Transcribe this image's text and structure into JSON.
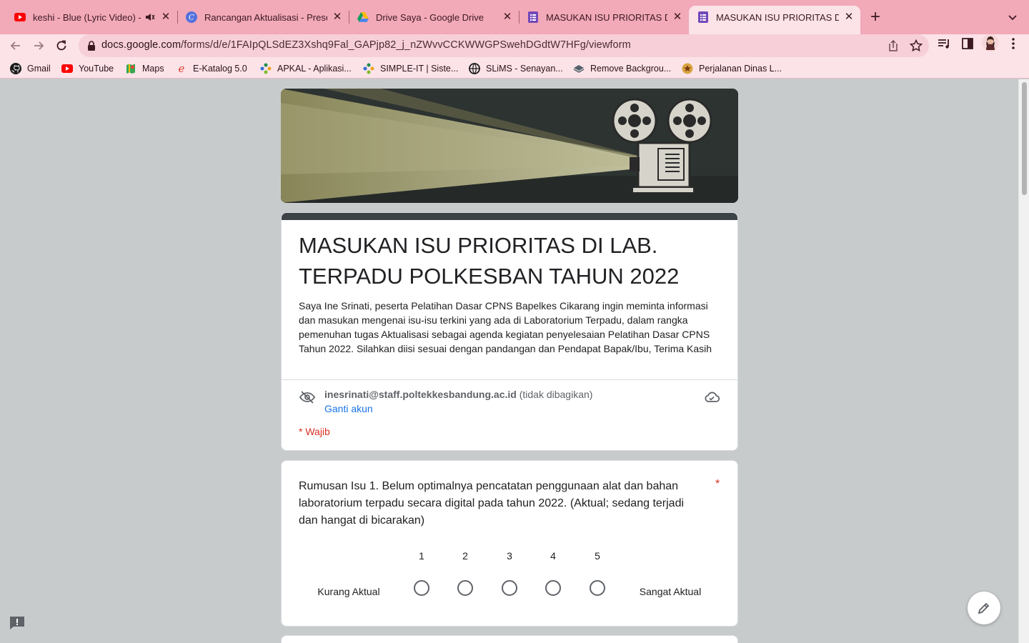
{
  "tabs": [
    {
      "title": "keshi - Blue (Lyric Video) - YouTube",
      "icon": "youtube-icon",
      "audio": true,
      "active": false
    },
    {
      "title": "Rancangan Aktualisasi - Presentasi",
      "icon": "canva-icon",
      "active": false
    },
    {
      "title": "Drive Saya - Google Drive",
      "icon": "google-drive-icon",
      "active": false
    },
    {
      "title": "MASUKAN ISU PRIORITAS DI LAB.",
      "icon": "google-forms-icon",
      "active": false
    },
    {
      "title": "MASUKAN ISU PRIORITAS DI LAB.",
      "icon": "google-forms-icon",
      "active": true
    }
  ],
  "address_bar": {
    "domain": "docs.google.com",
    "path": "/forms/d/e/1FAIpQLSdEZ3Xshq9Fal_GAPjp82_j_nZWvvCCKWWGPSwehDGdtW7HFg/viewform"
  },
  "bookmarks": [
    {
      "label": "Gmail",
      "icon": "github-icon"
    },
    {
      "label": "YouTube",
      "icon": "youtube-icon"
    },
    {
      "label": "Maps",
      "icon": "maps-icon"
    },
    {
      "label": "E-Katalog 5.0",
      "icon": "e-katalog-icon"
    },
    {
      "label": "APKAL - Aplikasi...",
      "icon": "apkal-icon"
    },
    {
      "label": "SIMPLE-IT | Siste...",
      "icon": "simple-it-icon"
    },
    {
      "label": "SLiMS - Senayan...",
      "icon": "slims-icon"
    },
    {
      "label": "Remove Backgrou...",
      "icon": "remove-bg-icon"
    },
    {
      "label": "Perjalanan Dinas L...",
      "icon": "perjalanan-dinas-icon"
    }
  ],
  "form": {
    "title": "MASUKAN ISU PRIORITAS DI LAB. TERPADU POLKESBAN TAHUN 2022",
    "description": "Saya Ine Srinati, peserta Pelatihan Dasar CPNS Bapelkes Cikarang ingin meminta informasi dan masukan mengenai isu-isu terkini yang ada di Laboratorium Terpadu, dalam rangka pemenuhan tugas Aktualisasi sebagai agenda kegiatan penyelesaian Pelatihan Dasar CPNS Tahun 2022. Silahkan diisi sesuai dengan pandangan dan Pendapat Bapak/Ibu, Terima Kasih",
    "account_email": "inesrinati@staff.poltekkesbandung.ac.id",
    "account_note": "(tidak dibagikan)",
    "switch_account": "Ganti akun",
    "required_note": "* Wajib"
  },
  "question1": {
    "text": "Rumusan Isu 1. Belum optimalnya pencatatan penggunaan alat dan bahan laboratorium terpadu secara digital pada tahun 2022. (Aktual; sedang terjadi dan hangat di bicarakan)",
    "required_mark": "*",
    "scale": [
      "1",
      "2",
      "3",
      "4",
      "5"
    ],
    "low_label": "Kurang Aktual",
    "high_label": "Sangat Aktual"
  },
  "colors": {
    "tab_bar": "#f2a9b8",
    "toolbar": "#fbe3e8",
    "page_bg": "#c8cbcc",
    "required": "#d93025",
    "link": "#1a73e8"
  }
}
